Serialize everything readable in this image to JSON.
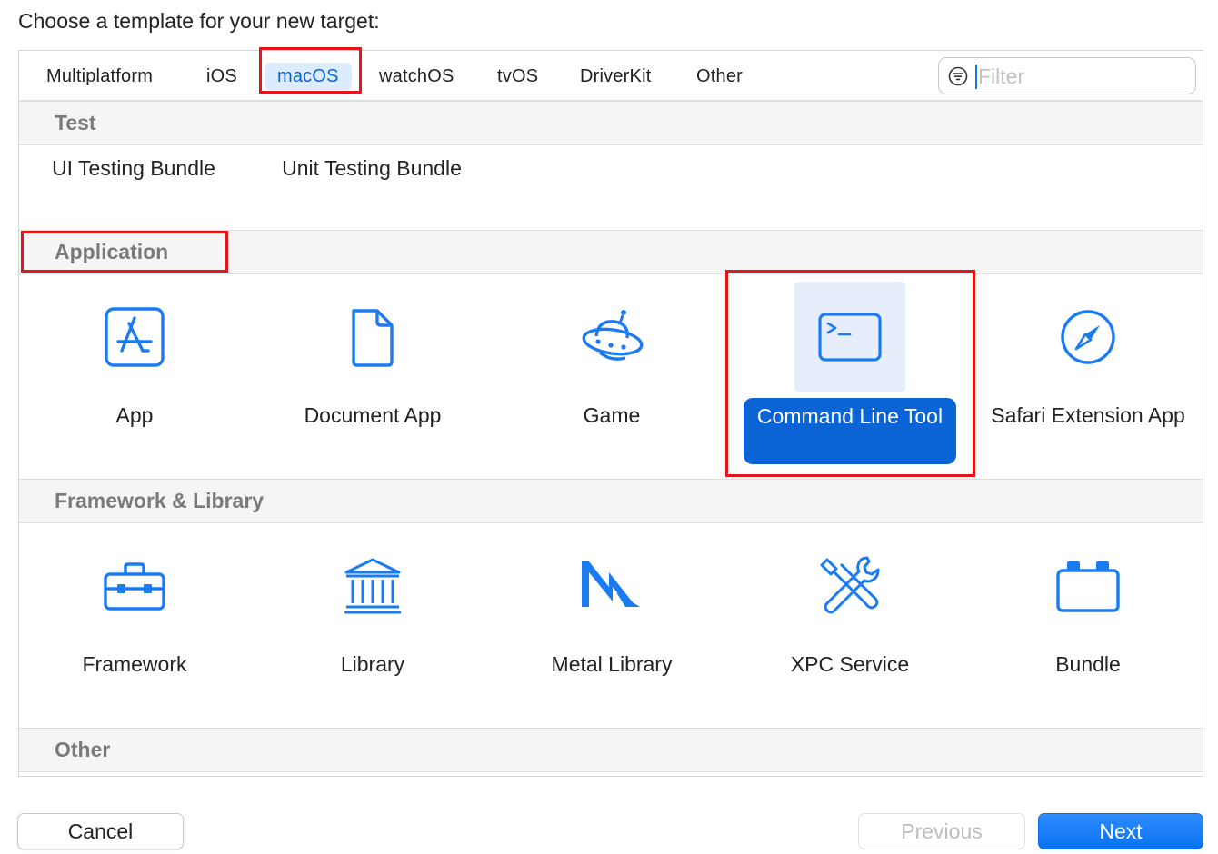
{
  "dialog": {
    "heading": "Choose a template for your new target:"
  },
  "tabs": [
    {
      "label": "Multiplatform"
    },
    {
      "label": "iOS"
    },
    {
      "label": "macOS",
      "selected": true
    },
    {
      "label": "watchOS"
    },
    {
      "label": "tvOS"
    },
    {
      "label": "DriverKit"
    },
    {
      "label": "Other"
    }
  ],
  "filter": {
    "placeholder": "Filter",
    "icon": "filter-circle-icon",
    "value": ""
  },
  "sections": {
    "test": {
      "title": "Test",
      "items": [
        {
          "label": "UI Testing Bundle"
        },
        {
          "label": "Unit Testing Bundle"
        }
      ]
    },
    "application": {
      "title": "Application",
      "items": [
        {
          "label": "App",
          "icon": "app-store-icon"
        },
        {
          "label": "Document App",
          "icon": "document-icon"
        },
        {
          "label": "Game",
          "icon": "ufo-icon"
        },
        {
          "label": "Command Line Tool",
          "icon": "terminal-icon",
          "selected": true
        },
        {
          "label": "Safari Extension App",
          "icon": "compass-icon"
        }
      ]
    },
    "framework": {
      "title": "Framework & Library",
      "items": [
        {
          "label": "Framework",
          "icon": "toolbox-icon"
        },
        {
          "label": "Library",
          "icon": "columns-building-icon"
        },
        {
          "label": "Metal Library",
          "icon": "metal-icon"
        },
        {
          "label": "XPC Service",
          "icon": "wrench-screwdriver-icon"
        },
        {
          "label": "Bundle",
          "icon": "bundle-brick-icon"
        }
      ]
    },
    "other": {
      "title": "Other"
    }
  },
  "buttons": {
    "cancel": "Cancel",
    "previous": "Previous",
    "next": "Next"
  },
  "colors": {
    "accent": "#0a64d6",
    "icon_blue": "#1a7bf2",
    "highlight_red": "#e3171b",
    "section_text": "#7a7a7a"
  }
}
